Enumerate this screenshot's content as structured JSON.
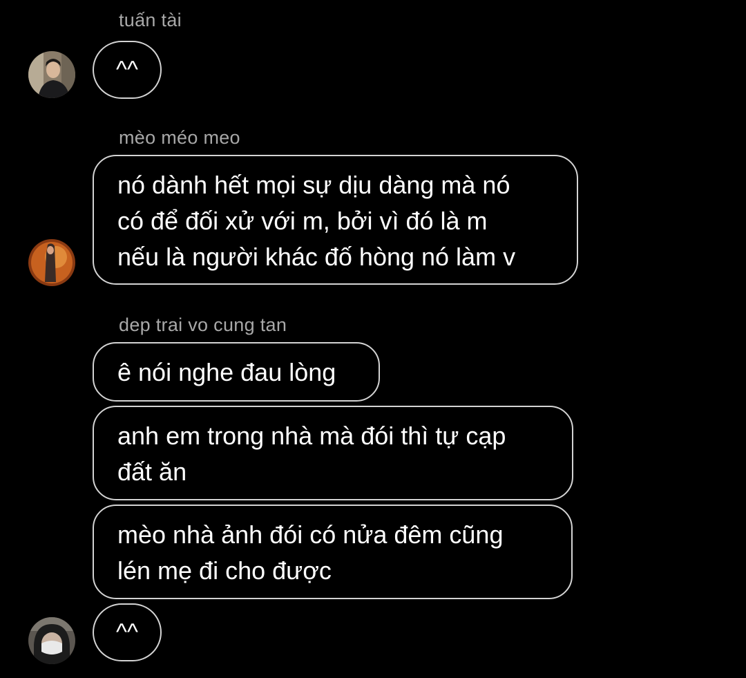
{
  "messages": [
    {
      "sender": "tuấn tài",
      "avatar_icon": "user-avatar-icon",
      "bubbles": [
        "^^"
      ]
    },
    {
      "sender": "mèo méo meo",
      "avatar_icon": "user-avatar-icon",
      "bubbles": [
        "nó dành hết mọi sự dịu dàng mà nó\ncó để đối xử với m, bởi vì đó là m\nnếu là người khác đố hòng nó làm v"
      ]
    },
    {
      "sender": "dep trai vo cung tan",
      "avatar_icon": "user-avatar-icon",
      "bubbles": [
        "ê nói nghe đau lòng",
        "anh em trong nhà mà đói thì tự cạp\nđất ăn",
        "mèo nhà ảnh đói có nửa đêm cũng\nlén mẹ đi cho được",
        "^^"
      ]
    }
  ],
  "colors": {
    "background": "#000000",
    "bubble_border": "#d4d4d4",
    "sender_name": "#a8a8a8",
    "text": "#ffffff"
  }
}
